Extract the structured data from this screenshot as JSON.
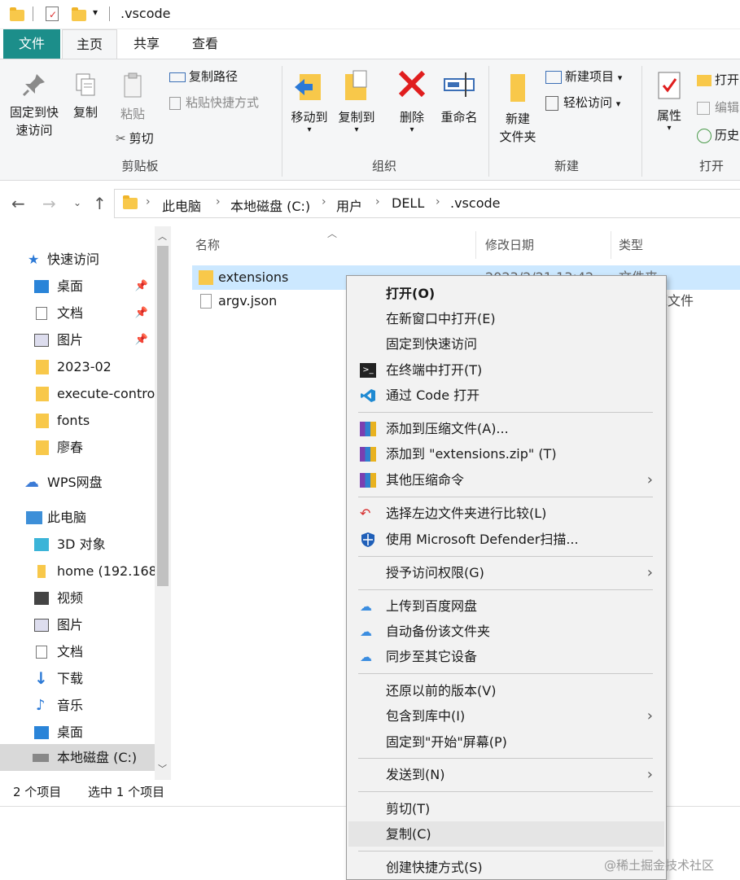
{
  "window": {
    "title": ".vscode"
  },
  "tabs": [
    {
      "label": "文件"
    },
    {
      "label": "主页"
    },
    {
      "label": "共享"
    },
    {
      "label": "查看"
    }
  ],
  "ribbon": {
    "clipboard": {
      "pin_line1": "固定到快",
      "pin_line2": "速访问",
      "copy": "复制",
      "paste": "粘贴",
      "copy_path": "复制路径",
      "paste_shortcut": "粘贴快捷方式",
      "cut": "剪切",
      "group": "剪贴板"
    },
    "organize": {
      "move_to": "移动到",
      "copy_to": "复制到",
      "delete": "删除",
      "rename": "重命名",
      "group": "组织"
    },
    "new": {
      "new_folder_line1": "新建",
      "new_folder_line2": "文件夹",
      "new_item": "新建项目",
      "easy_access": "轻松访问",
      "group": "新建"
    },
    "open": {
      "properties": "属性",
      "open": "打开",
      "edit": "编辑",
      "history": "历史",
      "group": "打开"
    }
  },
  "address": {
    "crumbs": [
      "此电脑",
      "本地磁盘 (C:)",
      "用户",
      "DELL",
      ".vscode"
    ]
  },
  "sidebar": {
    "items": [
      {
        "label": "快速访问",
        "icon": "star-icon"
      },
      {
        "label": "桌面",
        "icon": "desktop-icon",
        "pinned": true
      },
      {
        "label": "文档",
        "icon": "document-icon",
        "pinned": true
      },
      {
        "label": "图片",
        "icon": "picture-icon",
        "pinned": true
      },
      {
        "label": "2023-02",
        "icon": "folder-icon"
      },
      {
        "label": "execute-contro",
        "icon": "folder-icon"
      },
      {
        "label": "fonts",
        "icon": "folder-icon"
      },
      {
        "label": "廖春",
        "icon": "folder-icon"
      },
      {
        "label": "WPS网盘",
        "icon": "cloud-icon"
      },
      {
        "label": "此电脑",
        "icon": "computer-icon"
      },
      {
        "label": "3D 对象",
        "icon": "cube-icon"
      },
      {
        "label": "home (192.168",
        "icon": "network-drive-icon"
      },
      {
        "label": "视频",
        "icon": "video-icon"
      },
      {
        "label": "图片",
        "icon": "picture-icon"
      },
      {
        "label": "文档",
        "icon": "document-icon"
      },
      {
        "label": "下载",
        "icon": "download-icon"
      },
      {
        "label": "音乐",
        "icon": "music-icon"
      },
      {
        "label": "桌面",
        "icon": "desktop-icon"
      },
      {
        "label": "本地磁盘 (C:)",
        "icon": "drive-icon"
      }
    ]
  },
  "filelist": {
    "columns": [
      "名称",
      "修改日期",
      "类型"
    ],
    "rows": [
      {
        "name": "extensions",
        "date": "2023/2/21 13:42",
        "type": "文件夹"
      },
      {
        "name": "argv.json",
        "date": "",
        "type": "源文件"
      }
    ]
  },
  "status": {
    "count": "2 个项目",
    "selected": "选中 1 个项目"
  },
  "context_menu": {
    "items": [
      {
        "label": "打开(O)"
      },
      {
        "label": "在新窗口中打开(E)"
      },
      {
        "label": "固定到快速访问"
      },
      {
        "label": "在终端中打开(T)"
      },
      {
        "label": "通过 Code 打开"
      },
      {
        "label": "添加到压缩文件(A)..."
      },
      {
        "label": "添加到 \"extensions.zip\" (T)"
      },
      {
        "label": "其他压缩命令"
      },
      {
        "label": "选择左边文件夹进行比较(L)"
      },
      {
        "label": "使用 Microsoft Defender扫描..."
      },
      {
        "label": "授予访问权限(G)"
      },
      {
        "label": "上传到百度网盘"
      },
      {
        "label": "自动备份该文件夹"
      },
      {
        "label": "同步至其它设备"
      },
      {
        "label": "还原以前的版本(V)"
      },
      {
        "label": "包含到库中(I)"
      },
      {
        "label": "固定到\"开始\"屏幕(P)"
      },
      {
        "label": "发送到(N)"
      },
      {
        "label": "剪切(T)"
      },
      {
        "label": "复制(C)"
      },
      {
        "label": "创建快捷方式(S)"
      }
    ]
  },
  "watermark": "@稀土掘金技术社区",
  "colors": {
    "file_tab": "#1c8e8a",
    "selection": "#cce8ff",
    "folder": "#f8c84a"
  }
}
